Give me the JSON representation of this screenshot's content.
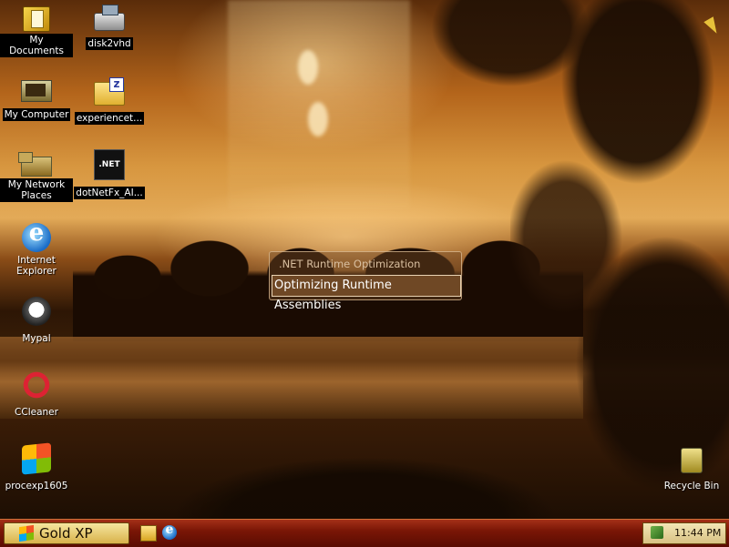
{
  "desktop": {
    "icons": [
      {
        "label": "My Documents",
        "icon": "my-documents-icon"
      },
      {
        "label": "disk2vhd",
        "icon": "disk2vhd-icon"
      },
      {
        "label": "My Computer",
        "icon": "my-computer-icon"
      },
      {
        "label": "experiencet...",
        "icon": "zip-folder-icon"
      },
      {
        "label": "My Network Places",
        "icon": "network-places-icon"
      },
      {
        "label": "dotNetFx_AI...",
        "icon": "dotnet-icon"
      },
      {
        "label": "Internet Explorer",
        "icon": "internet-explorer-icon"
      },
      {
        "label": "Mypal",
        "icon": "mypal-icon"
      },
      {
        "label": "CCleaner",
        "icon": "ccleaner-icon"
      },
      {
        "label": "procexp1605",
        "icon": "procexp-icon"
      },
      {
        "label": "Recycle Bin",
        "icon": "recycle-bin-icon"
      }
    ],
    "net_glyph": ".NET"
  },
  "popup": {
    "title": ".NET Runtime Optimization",
    "message": "Optimizing Runtime Assemblies"
  },
  "taskbar": {
    "start_label": "Gold XP",
    "quick_launch": [
      "folder-icon",
      "internet-explorer-icon"
    ],
    "clock": "11:44 PM",
    "accent": "#7a1606"
  }
}
